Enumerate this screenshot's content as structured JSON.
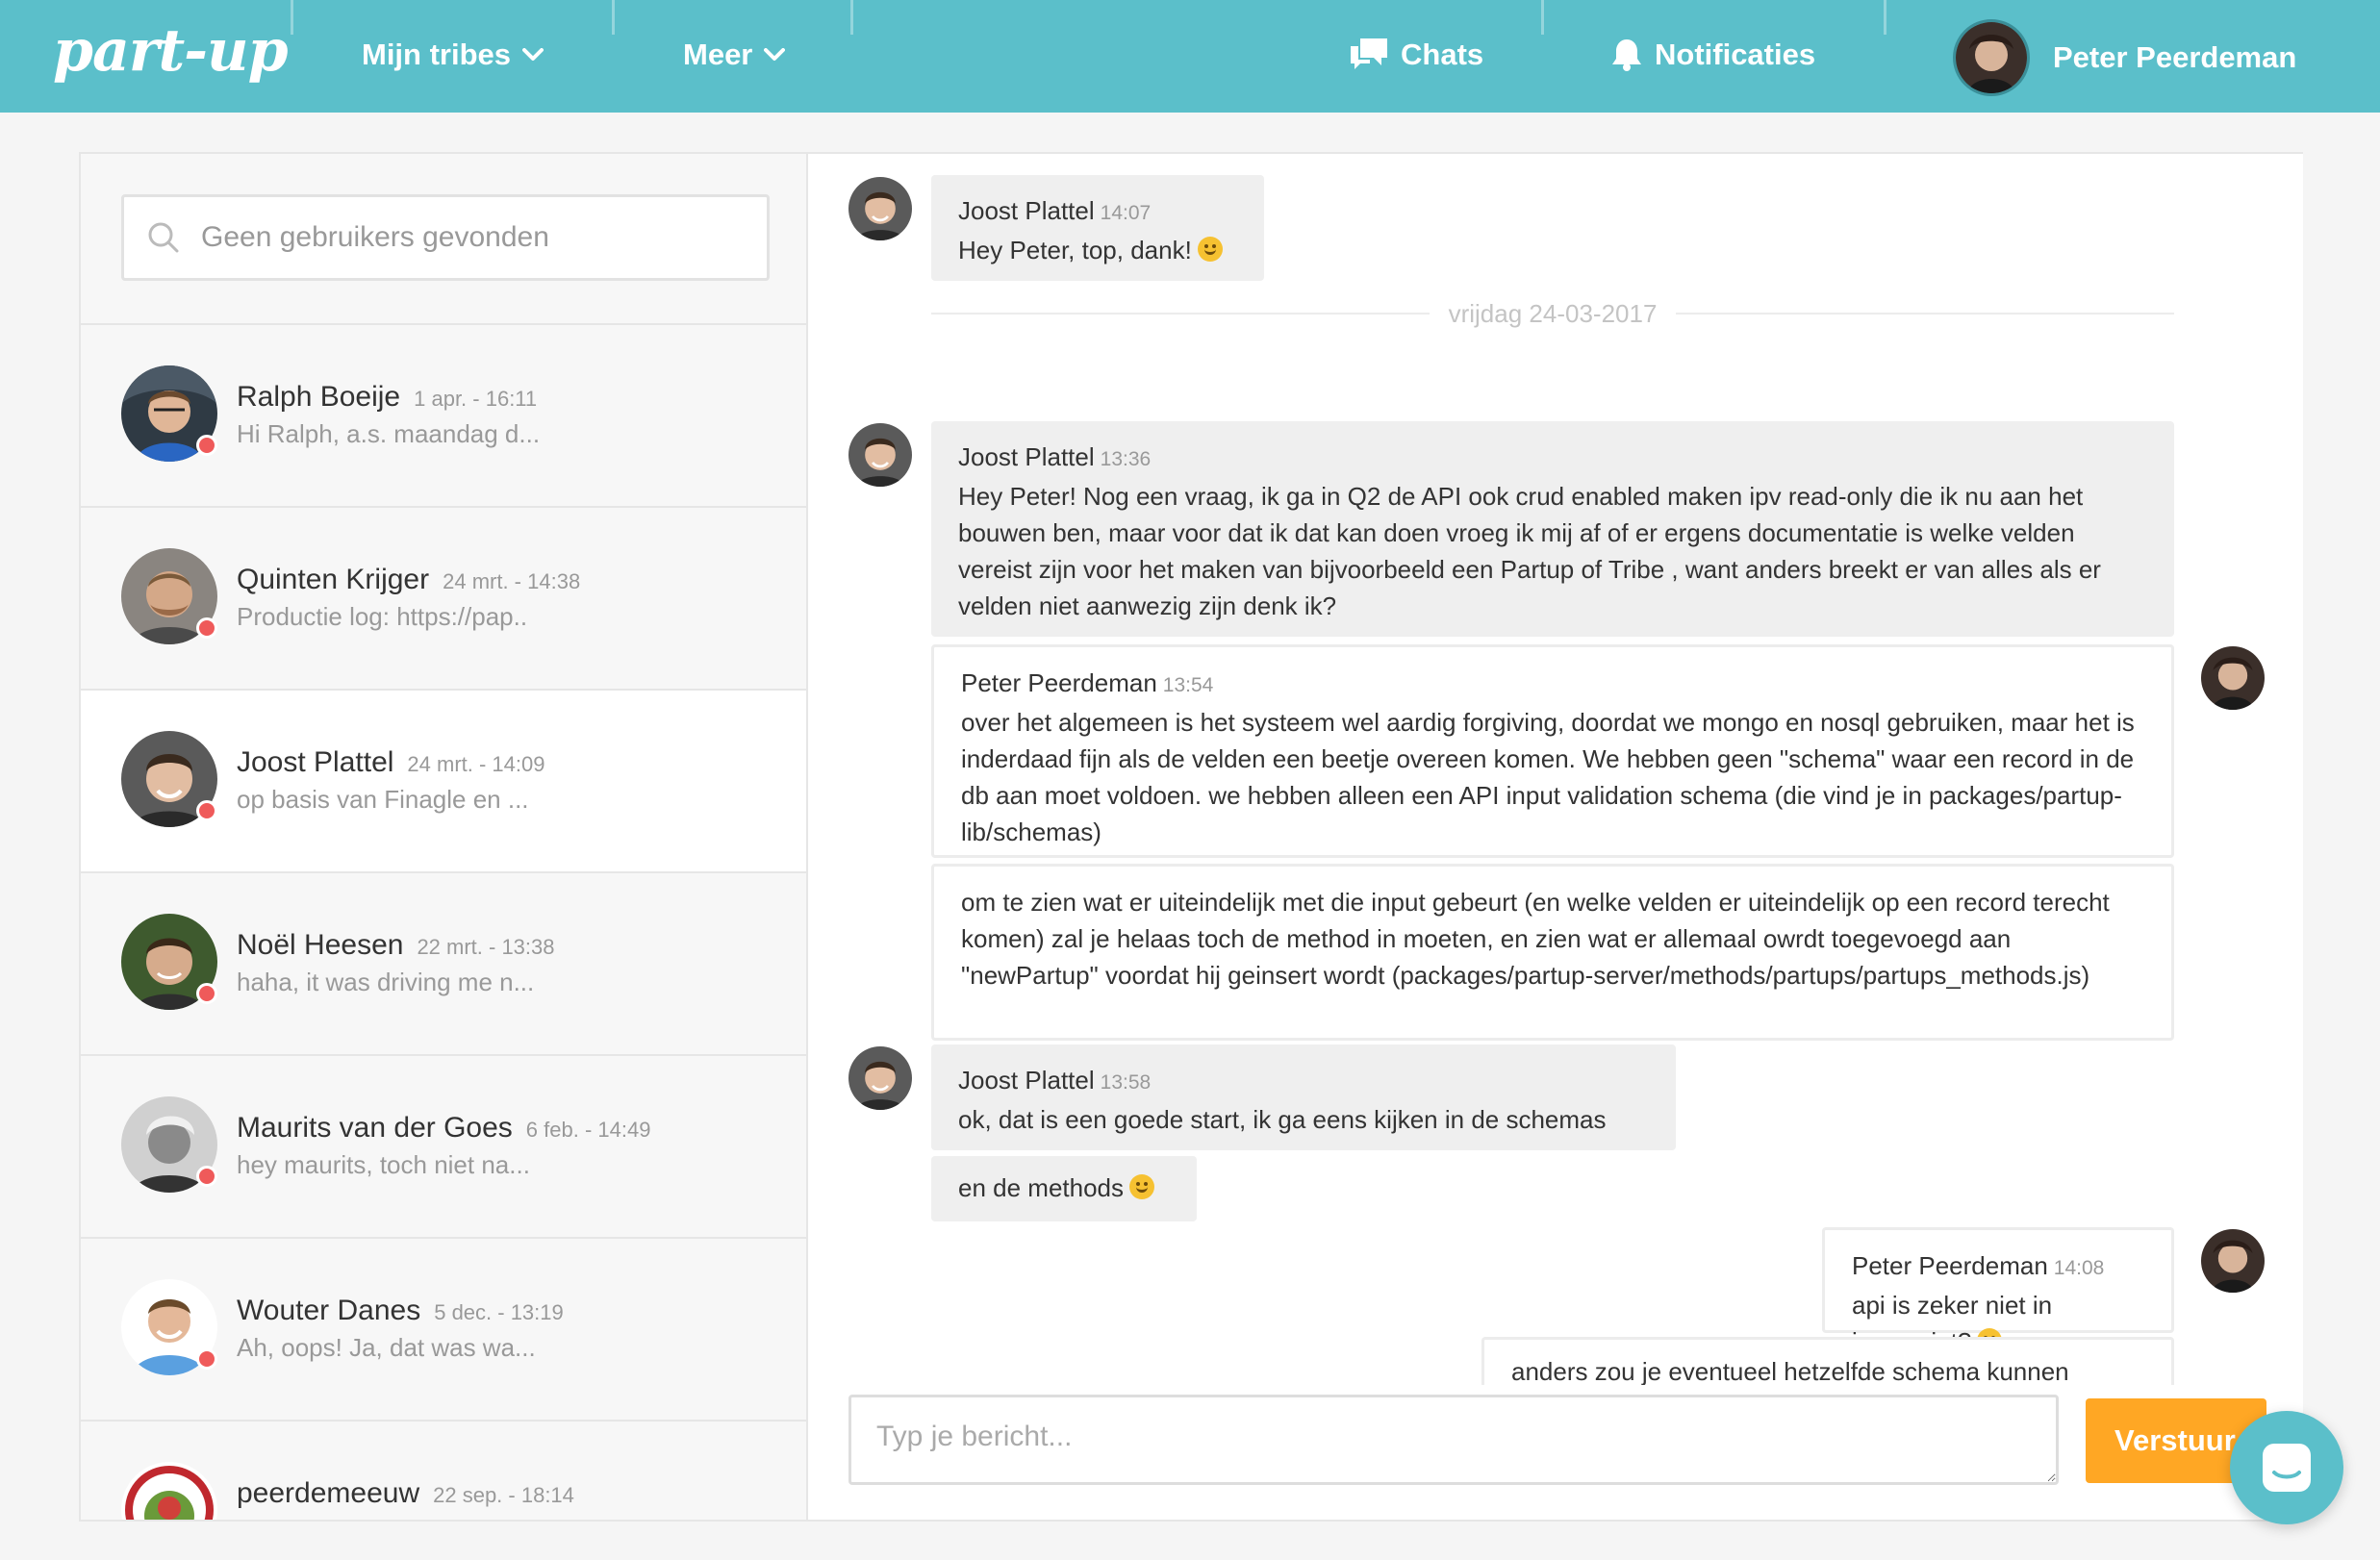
{
  "brand": {
    "logo_text": "part-up",
    "primary_color": "#5bbfca",
    "accent_color": "#ffa724",
    "online_dot_color": "#ef5a5a"
  },
  "nav": {
    "tribes_label": "Mijn tribes",
    "more_label": "Meer",
    "chats_label": "Chats",
    "notifications_label": "Notificaties",
    "user_name": "Peter Peerdeman"
  },
  "sidebar": {
    "search_placeholder": "Geen gebruikers gevonden",
    "contacts": [
      {
        "name": "Ralph Boeije",
        "time": "1 apr. - 16:11",
        "preview": "Hi Ralph, a.s. maandag d...",
        "active": false
      },
      {
        "name": "Quinten Krijger",
        "time": "24 mrt. - 14:38",
        "preview": "Productie log: https://pap..",
        "active": false
      },
      {
        "name": "Joost Plattel",
        "time": "24 mrt. - 14:09",
        "preview": "op basis van Finagle en ...",
        "active": true
      },
      {
        "name": "Noël Heesen",
        "time": "22 mrt. - 13:38",
        "preview": "haha, it was driving me n...",
        "active": false
      },
      {
        "name": "Maurits van der Goes",
        "time": "6 feb. - 14:49",
        "preview": "hey maurits, toch niet na...",
        "active": false
      },
      {
        "name": "Wouter Danes",
        "time": "5 dec. - 13:19",
        "preview": "Ah, oops! Ja, dat was wa...",
        "active": false
      },
      {
        "name": "peerdemeeuw",
        "time": "22 sep. - 18:14",
        "preview": "",
        "active": false
      }
    ]
  },
  "chat": {
    "day_separator": "vrijdag 24-03-2017",
    "messages": [
      {
        "sender": "Joost Plattel",
        "time": "14:07",
        "text": "Hey Peter, top, dank!",
        "emoji": "smile"
      },
      {
        "sender": "Joost Plattel",
        "time": "13:36",
        "text": "Hey Peter! Nog een vraag, ik ga in Q2 de API ook crud enabled maken ipv read-only die ik nu aan het bouwen ben, maar voor dat ik dat kan doen vroeg ik mij af of er ergens documentatie is welke velden vereist zijn voor het maken van bijvoorbeeld een Partup of Tribe , want anders breekt er van alles als er velden niet aanwezig zijn denk ik?"
      },
      {
        "sender": "Peter Peerdeman",
        "time": "13:54",
        "text": "over het algemeen is het systeem wel aardig forgiving, doordat we mongo en nosql gebruiken, maar het is inderdaad fijn als de velden een beetje overeen komen. We hebben geen \"schema\" waar een record in de db aan moet voldoen. we hebben alleen een API input validation schema (die vind je in packages/partup-lib/schemas)"
      },
      {
        "text": "om te zien wat er uiteindelijk met die input gebeurt (en welke velden er uiteindelijk op een record terecht komen) zal je helaas toch de method in moeten, en zien wat er allemaal owrdt toegevoegd aan \"newPartup\" voordat hij geinsert wordt (packages/partup-server/methods/partups/partups_methods.js)"
      },
      {
        "sender": "Joost Plattel",
        "time": "13:58",
        "text": "ok, dat is een goede start, ik ga eens kijken in de schemas"
      },
      {
        "text": "en de methods",
        "emoji": "smile"
      },
      {
        "sender": "Peter Peerdeman",
        "time": "14:08",
        "text": "api is zeker niet in javascript?",
        "emoji": "wow"
      },
      {
        "text": "anders zou je eventueel hetzelfde schema kunnen gebruiken"
      }
    ]
  },
  "composer": {
    "placeholder": "Typ je bericht...",
    "send_label": "Verstuur"
  }
}
